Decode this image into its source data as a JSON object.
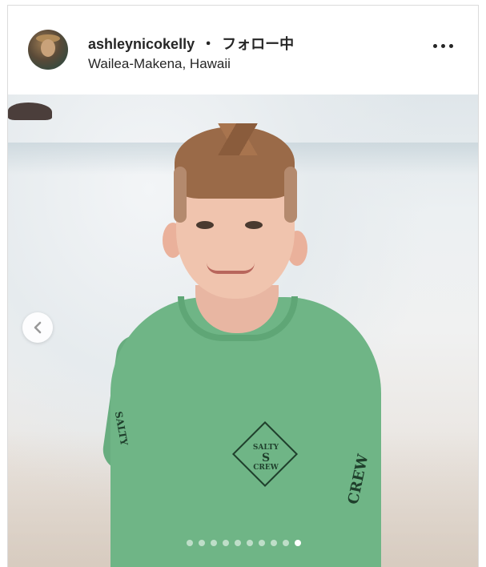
{
  "post": {
    "username": "ashleynicokelly",
    "separator": "・",
    "follow_status": "フォロー中",
    "location": "Wailea-Makena, Hawaii"
  },
  "icons": {
    "more": "more-options-icon",
    "prev": "chevron-left-icon"
  },
  "photo": {
    "logo_top": "SALTY",
    "logo_mid": "S",
    "logo_bottom": "CREW",
    "sleeve_right": "CREW",
    "sleeve_left": "SALTY"
  },
  "carousel": {
    "total": 10,
    "active_index": 9
  },
  "colors": {
    "text": "#262626",
    "border": "#dbdbdb",
    "shirt": "#6fb586"
  }
}
